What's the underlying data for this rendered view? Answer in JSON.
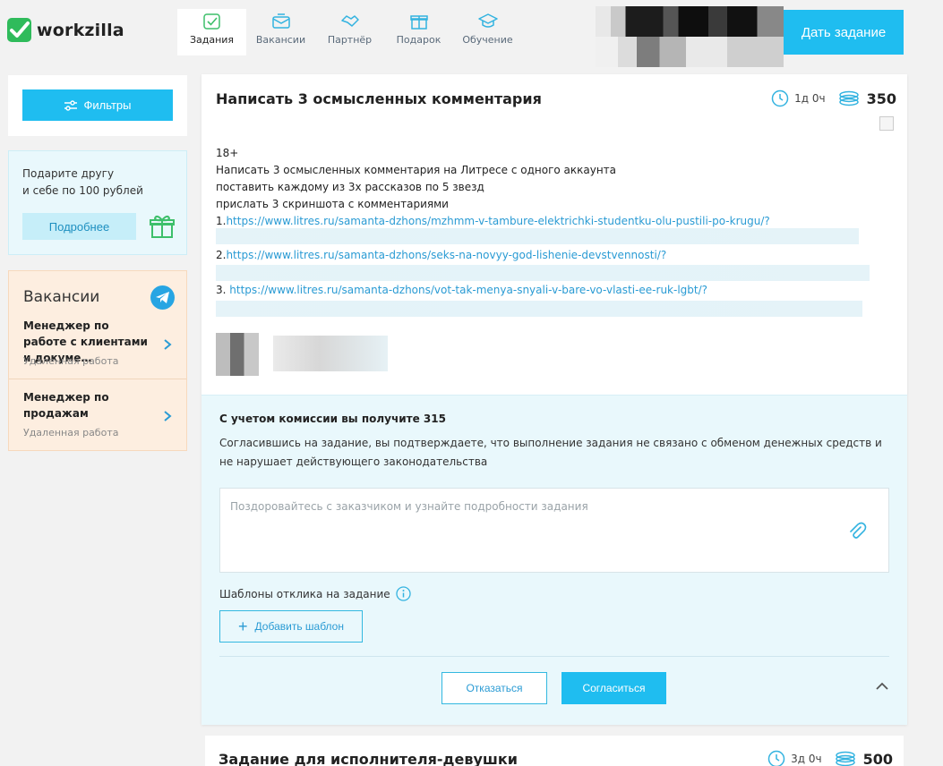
{
  "header": {
    "logo_text": "workzilla",
    "nav": [
      {
        "label": "Задания",
        "icon": "tasks-icon",
        "active": true
      },
      {
        "label": "Вакансии",
        "icon": "mail-icon",
        "active": false
      },
      {
        "label": "Партнёр",
        "icon": "handshake-icon",
        "active": false
      },
      {
        "label": "Подарок",
        "icon": "gift-icon",
        "active": false
      },
      {
        "label": "Обучение",
        "icon": "graduation-cap-icon",
        "active": false
      }
    ],
    "give_task_label": "Дать задание"
  },
  "sidebar": {
    "filters_label": "Фильтры",
    "promo": {
      "line1": "Подарите другу",
      "line2": "и себе по 100 рублей",
      "button_label": "Подробнее"
    },
    "vacancies": {
      "title": "Вакансии",
      "items": [
        {
          "title": "Менеджер по работе с клиентами и докуме…",
          "subtitle": "Удаленная работа"
        },
        {
          "title": "Менеджер по продажам",
          "subtitle": "Удаленная работа"
        }
      ]
    }
  },
  "task": {
    "title": "Написать 3 осмысленных комментария",
    "time": "1д 0ч",
    "price": "350",
    "description": [
      "18+",
      "Написать 3 осмысленных комментария на Литресе с одного аккаунта",
      "поставить каждому из 3х рассказов по 5 звезд",
      "прислать 3 скриншота с комментариями"
    ],
    "links": [
      {
        "prefix": "1.",
        "url": "https://www.litres.ru/samanta-dzhons/mzhmm-v-tambure-elektrichki-studentku-olu-pustili-po-krugu/?"
      },
      {
        "prefix": "2.",
        "url": "https://www.litres.ru/samanta-dzhons/seks-na-novyy-god-lishenie-devstvennosti/?"
      },
      {
        "prefix": "3. ",
        "url": "https://www.litres.ru/samanta-dzhons/vot-tak-menya-snyali-v-bare-vo-vlasti-ee-ruk-lgbt/?"
      }
    ],
    "offer": {
      "commission_text": "С учетом комиссии вы получите 315",
      "agreement_text": "Согласившись на задание, вы подтверждаете, что выполнение задания не связано с обменом денежных средств и не нарушает действующего законодательства",
      "message_placeholder": "Поздоровайтесь с заказчиком и узнайте подробности задания",
      "templates_label": "Шаблоны отклика на задание",
      "add_template_label": "Добавить шаблон",
      "decline_label": "Отказаться",
      "accept_label": "Согласиться"
    }
  },
  "task2": {
    "title": "Задание для исполнителя-девушки",
    "time": "3д 0ч",
    "price": "500"
  },
  "colors": {
    "accent": "#1fbdf0",
    "link": "#2a9bd4",
    "logo_green": "#2fbb5b",
    "offer_bg": "#e9f8fc",
    "vacancy_bg": "#fdeee0"
  }
}
